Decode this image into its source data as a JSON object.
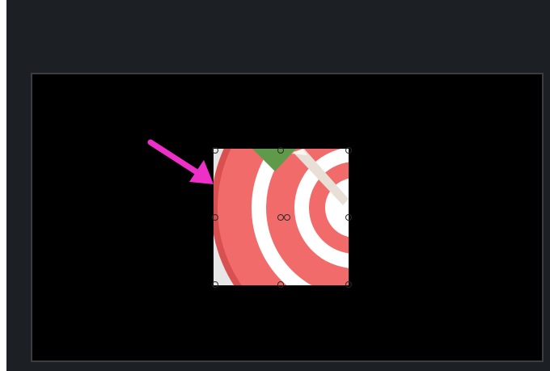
{
  "editor": {
    "background_color": "#1c1f23",
    "canvas_color": "#000000",
    "canvas_border_color": "#3a3d42"
  },
  "clip": {
    "content": "target-bullseye-image",
    "selected": true,
    "colors": {
      "ring_red": "#f26b6b",
      "ring_white": "#ffffff",
      "backdrop": "#e6e6e6",
      "leaf": "#5f9a4a",
      "dart": "#e8e0d6"
    }
  },
  "annotation": {
    "icon": "pointer-arrow-icon",
    "color": "#ee2fc8"
  }
}
